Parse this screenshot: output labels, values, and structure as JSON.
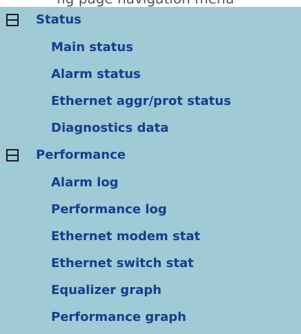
{
  "header_fragment": {
    "text": "ng page navigation menu"
  },
  "menu": {
    "groups": [
      {
        "label": "Status",
        "expanded": true,
        "icon": "collapse-minus-icon",
        "items": [
          {
            "label": "Main status"
          },
          {
            "label": "Alarm status"
          },
          {
            "label": "Ethernet aggr/prot status"
          },
          {
            "label": "Diagnostics data"
          }
        ]
      },
      {
        "label": "Performance",
        "expanded": true,
        "icon": "collapse-minus-icon",
        "items": [
          {
            "label": "Alarm log"
          },
          {
            "label": "Performance log"
          },
          {
            "label": "Ethernet modem stat"
          },
          {
            "label": "Ethernet switch stat"
          },
          {
            "label": "Equalizer graph"
          },
          {
            "label": "Performance graph"
          }
        ]
      }
    ]
  },
  "colors": {
    "panel_background": "#9fcad6",
    "link_text": "#193c8c",
    "icon_stroke": "#1b1b1b"
  }
}
